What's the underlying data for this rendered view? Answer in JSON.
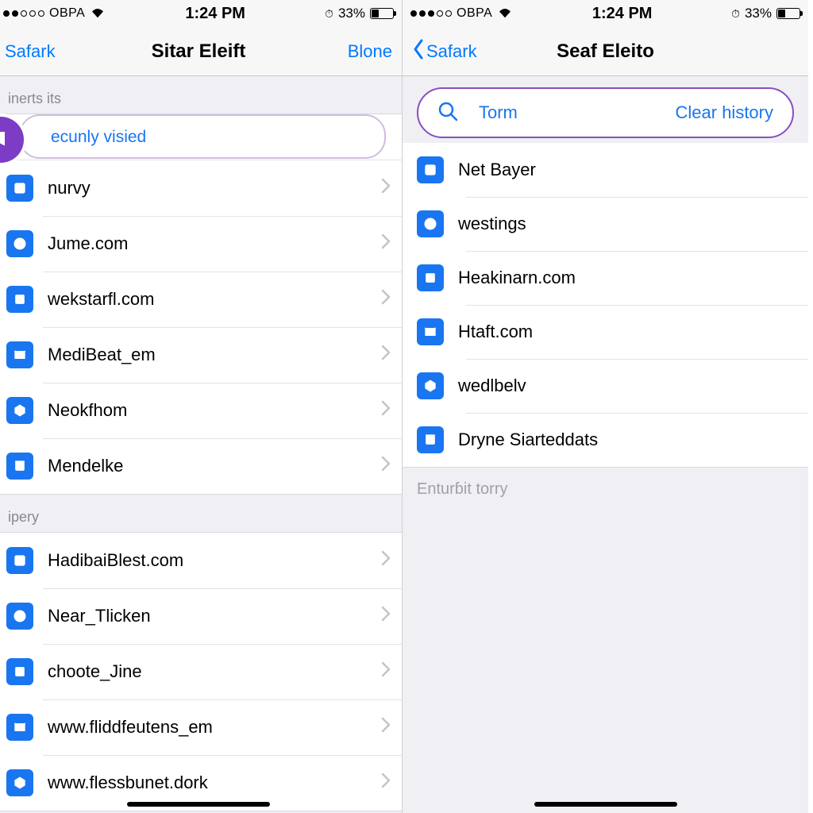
{
  "status": {
    "carrier": "OBPA",
    "time": "1:24 PM",
    "battery_pct": "33%"
  },
  "left": {
    "back_label": "Safark",
    "title": "Sitar Eleift",
    "action_label": "Blone",
    "section1_header": "inerts its",
    "highlight_label": "ecunly visied",
    "rows1": [
      {
        "label": "nurvy"
      },
      {
        "label": "Jume.com"
      },
      {
        "label": "wekstarfl.com"
      },
      {
        "label": "MediBeat_em"
      },
      {
        "label": "Neokfhom"
      },
      {
        "label": "Mendelke"
      }
    ],
    "section2_header": "ipery",
    "rows2": [
      {
        "label": "HadibaiBlest.com"
      },
      {
        "label": "Near_Tlicken"
      },
      {
        "label": "choote_Jine"
      },
      {
        "label": "www.fliddfeutens_em"
      },
      {
        "label": "www.flessbunet.dork"
      }
    ]
  },
  "right": {
    "back_label": "Safark",
    "title": "Seaf Eleito",
    "search_term": "Torm",
    "clear_label": "Clear history",
    "rows": [
      {
        "label": "Net Bayer"
      },
      {
        "label": "westings"
      },
      {
        "label": "Heakinarn.com"
      },
      {
        "label": "Htaft.com"
      },
      {
        "label": "wedlbelv"
      },
      {
        "label": "Dryne Siarteddats"
      }
    ],
    "footer": "Enturɓit torry"
  }
}
